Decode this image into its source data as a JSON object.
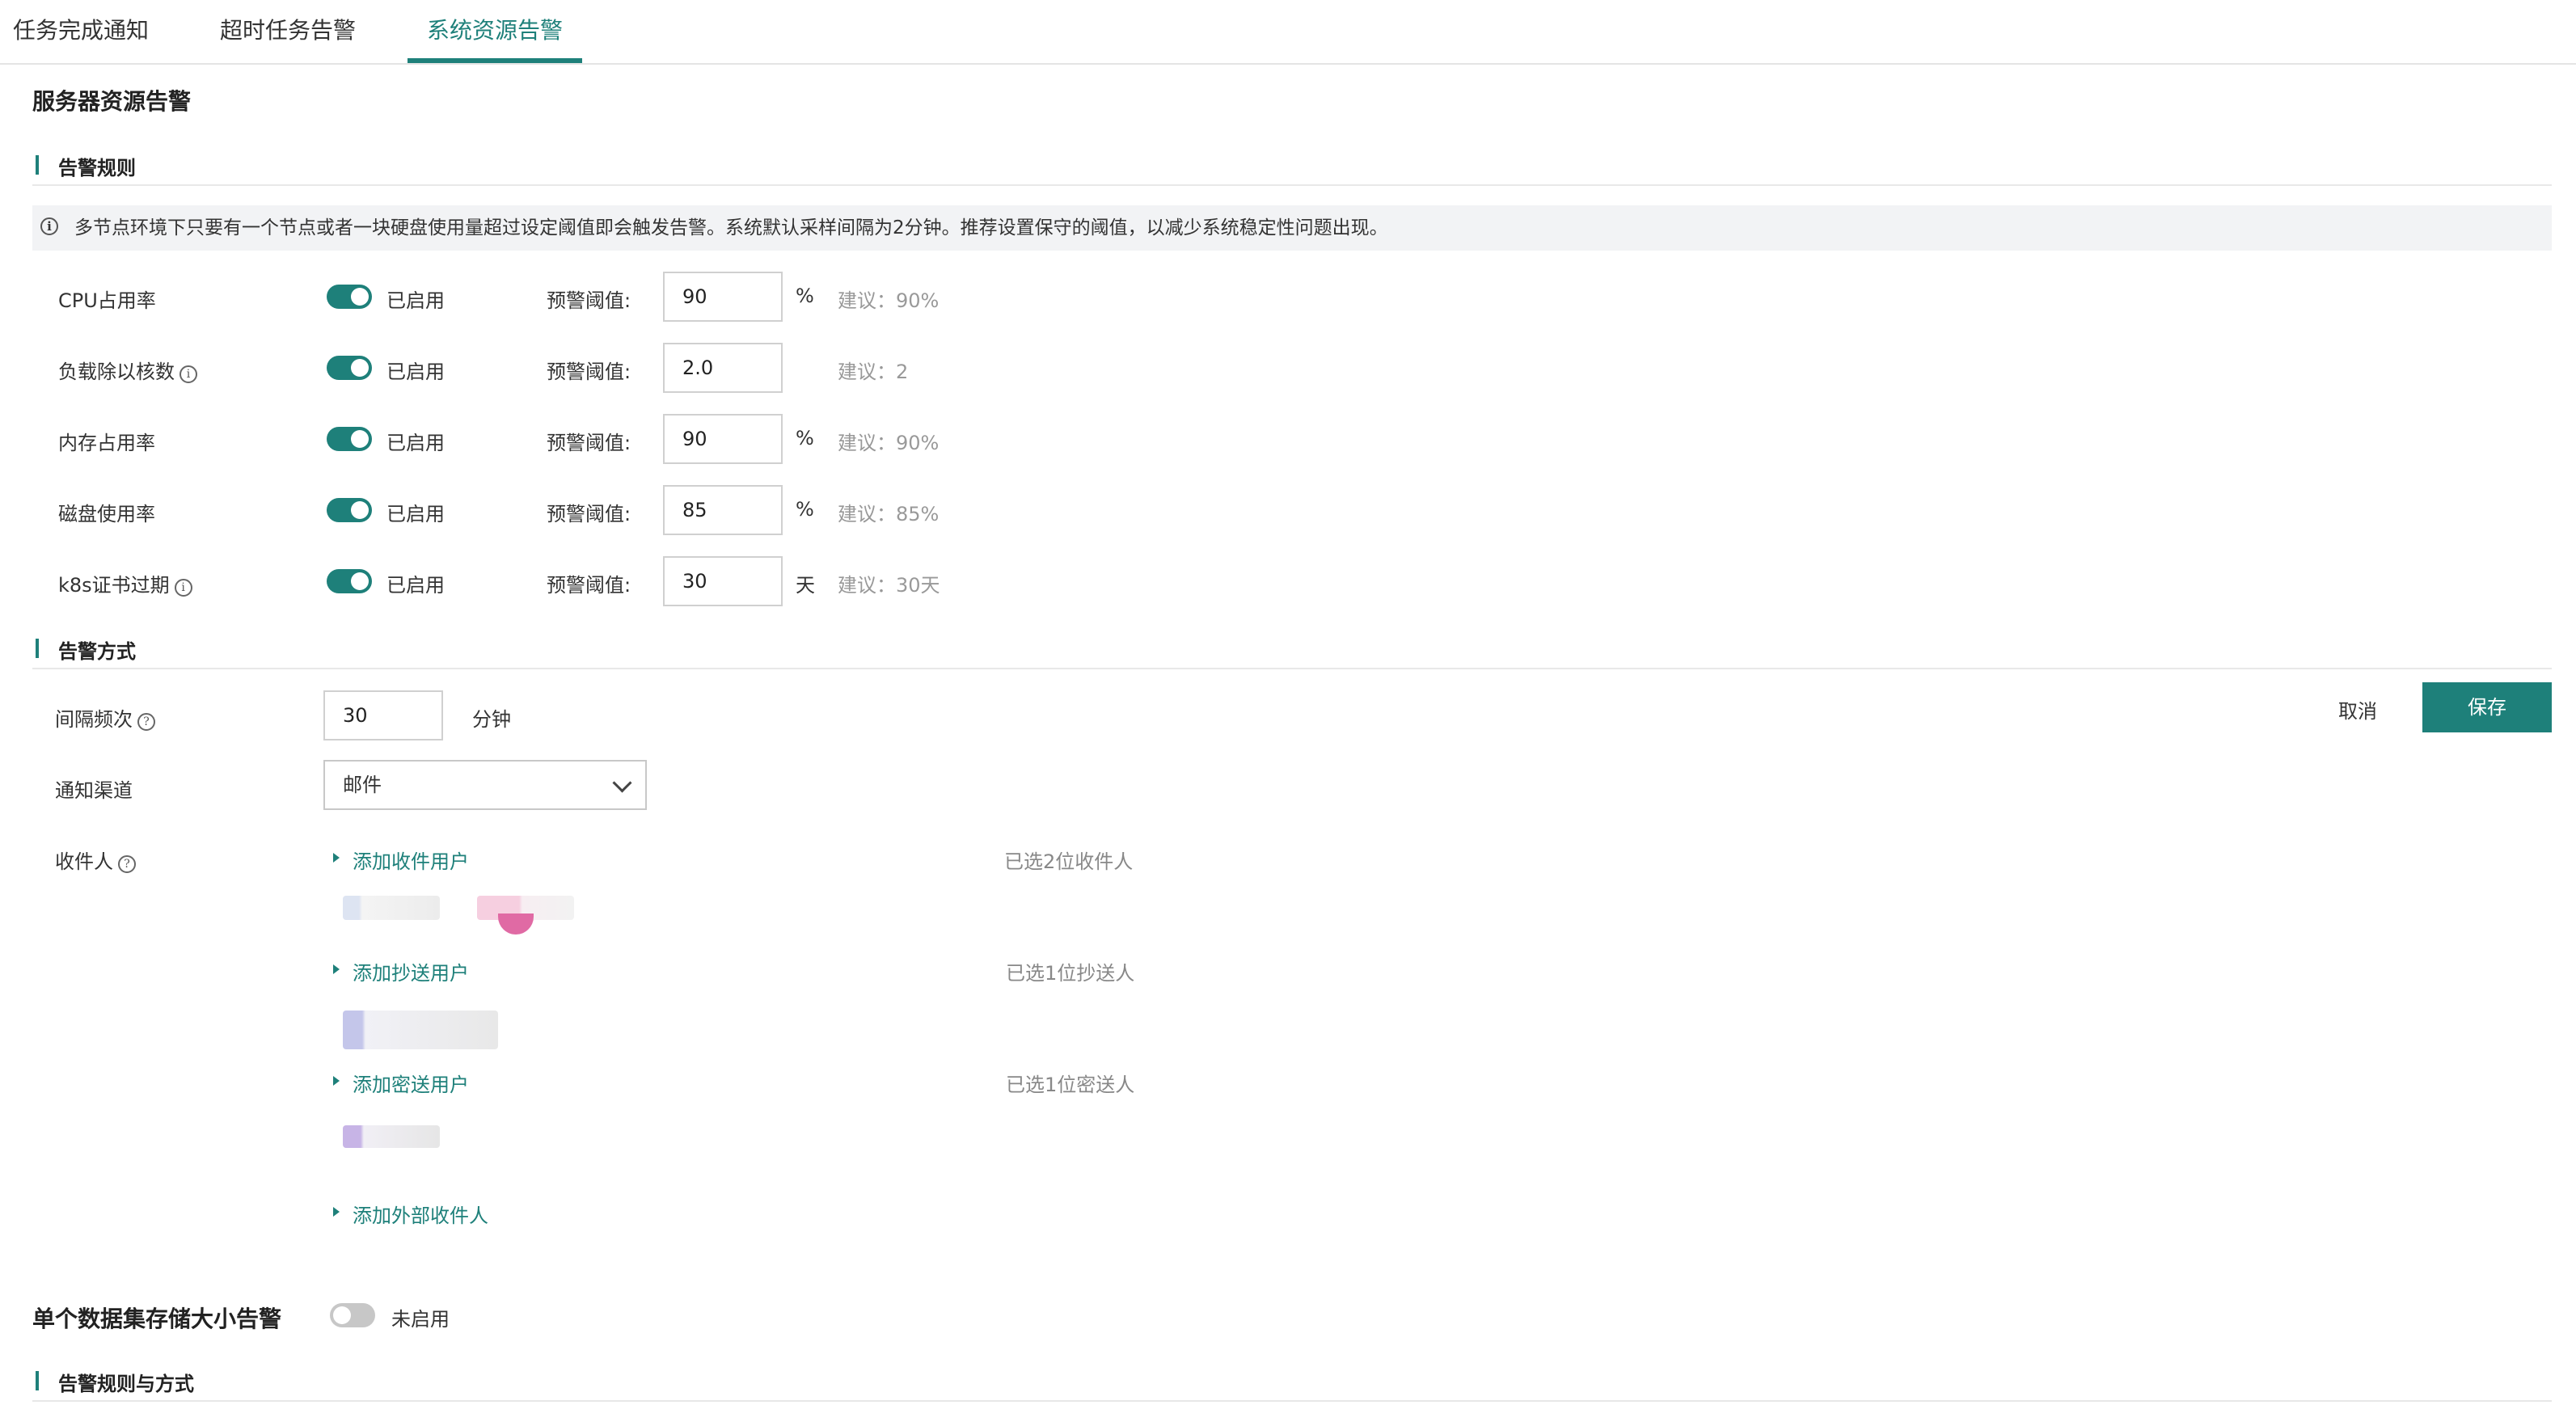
{
  "tabs": [
    {
      "label": "任务完成通知"
    },
    {
      "label": "超时任务告警"
    },
    {
      "label": "系统资源告警"
    }
  ],
  "server_section": {
    "title": "服务器资源告警"
  },
  "rules": {
    "title": "告警规则",
    "notice": "多节点环境下只要有一个节点或者一块硬盘使用量超过设定阈值即会触发告警。系统默认采样间隔为2分钟。推荐设置保守的阈值，以减少系统稳定性问题出现。",
    "threshold_label": "预警阈值:",
    "items": [
      {
        "label": "CPU占用率",
        "status": "已启用",
        "value": "90",
        "unit": "%",
        "hint": "建议：90%"
      },
      {
        "label": "负载除以核数",
        "status": "已启用",
        "value": "2.0",
        "unit": "",
        "hint": "建议：2"
      },
      {
        "label": "内存占用率",
        "status": "已启用",
        "value": "90",
        "unit": "%",
        "hint": "建议：90%"
      },
      {
        "label": "磁盘使用率",
        "status": "已启用",
        "value": "85",
        "unit": "%",
        "hint": "建议：85%"
      },
      {
        "label": "k8s证书过期",
        "status": "已启用",
        "value": "30",
        "unit": "天",
        "hint": "建议：30天"
      }
    ]
  },
  "method": {
    "title": "告警方式",
    "interval_label": "间隔频次",
    "interval_value": "30",
    "interval_unit": "分钟",
    "channel_label": "通知渠道",
    "channel_value": "邮件",
    "recipient_label": "收件人",
    "add_recipient": "添加收件用户",
    "recipient_count": "已选2位收件人",
    "add_cc": "添加抄送用户",
    "cc_count": "已选1位抄送人",
    "add_bcc": "添加密送用户",
    "bcc_count": "已选1位密送人",
    "add_external": "添加外部收件人"
  },
  "actions": {
    "cancel": "取消",
    "save": "保存"
  },
  "dataset_section": {
    "title": "单个数据集存储大小告警",
    "status": "未启用"
  },
  "rules_and_method": {
    "title": "告警规则与方式"
  },
  "colors": {
    "accent": "#1e807a",
    "toggle_off": "#c7c7c7"
  }
}
